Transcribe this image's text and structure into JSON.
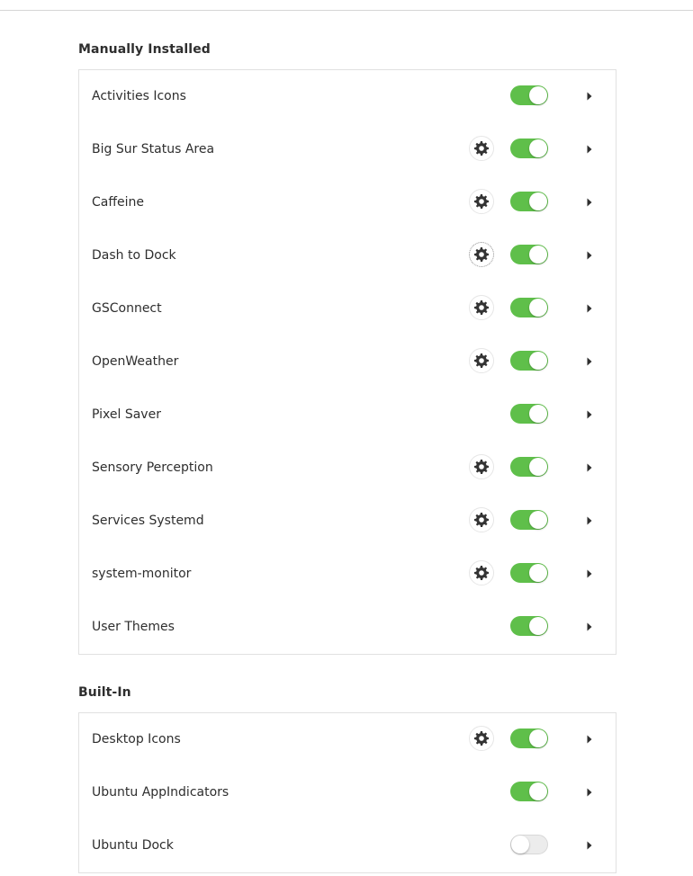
{
  "sections": [
    {
      "title": "Manually Installed",
      "items": [
        {
          "name": "Activities Icons",
          "has_settings": false,
          "enabled": true
        },
        {
          "name": "Big Sur Status Area",
          "has_settings": true,
          "enabled": true
        },
        {
          "name": "Caffeine",
          "has_settings": true,
          "enabled": true
        },
        {
          "name": "Dash to Dock",
          "has_settings": true,
          "enabled": true,
          "focused": true
        },
        {
          "name": "GSConnect",
          "has_settings": true,
          "enabled": true
        },
        {
          "name": "OpenWeather",
          "has_settings": true,
          "enabled": true
        },
        {
          "name": "Pixel Saver",
          "has_settings": false,
          "enabled": true
        },
        {
          "name": "Sensory Perception",
          "has_settings": true,
          "enabled": true
        },
        {
          "name": "Services Systemd",
          "has_settings": true,
          "enabled": true
        },
        {
          "name": "system-monitor",
          "has_settings": true,
          "enabled": true
        },
        {
          "name": "User Themes",
          "has_settings": false,
          "enabled": true
        }
      ]
    },
    {
      "title": "Built-In",
      "items": [
        {
          "name": "Desktop Icons",
          "has_settings": true,
          "enabled": true
        },
        {
          "name": "Ubuntu AppIndicators",
          "has_settings": false,
          "enabled": true
        },
        {
          "name": "Ubuntu Dock",
          "has_settings": false,
          "enabled": false
        }
      ]
    }
  ],
  "icons": {
    "settings": "gear-icon",
    "expand": "chevron-right-icon"
  },
  "colors": {
    "toggle_on": "#5fbf4a",
    "toggle_off": "#ececec",
    "text": "#2e2e2e",
    "border": "#e1e1e1"
  }
}
